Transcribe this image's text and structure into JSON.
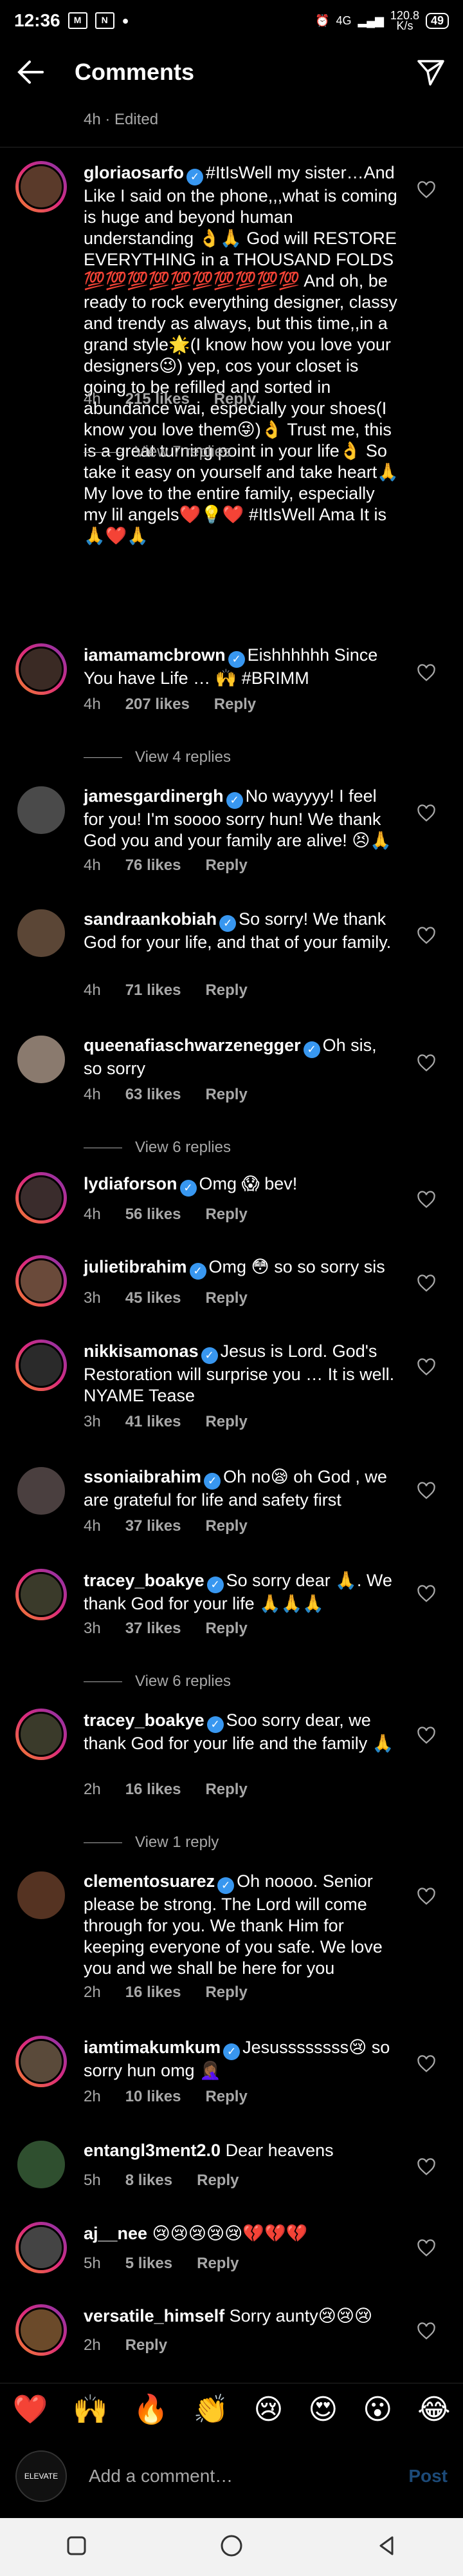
{
  "status_bar": {
    "time": "12:36",
    "net_speed": "120.8",
    "net_unit": "K/s",
    "signal": "4G",
    "battery": "49"
  },
  "header": {
    "title": "Comments"
  },
  "edited_caption": "4h · Edited",
  "labels": {
    "likes_suffix": "likes",
    "reply": "Reply"
  },
  "comments": [
    {
      "username": "gloriaosarfo",
      "verified": true,
      "text": "#ItIsWell my sister…And Like I said on the phone,,,what is coming is huge and beyond human understanding 👌🙏 God will RESTORE EVERYTHING in a THOUSAND FOLDS 💯💯💯💯💯💯💯💯💯💯 And oh, be ready to rock everything designer, classy and trendy as always, but this time,,in a grand style🌟(I know how you love your designers😉) yep, cos your closet is going to be refilled and sorted in abundance wai, especially your shoes(I know you love them😜)👌 Trust me, this is a great turning point in your life👌 So take it easy on yourself and take heart🙏 My love to the entire family, especially my lil angels❤️💡❤️ #ItIsWell Ama It is🙏❤️🙏",
      "time": "4h",
      "likes": "215 likes",
      "reply_link": "View 7 replies"
    },
    {
      "username": "iamamamcbrown",
      "verified": true,
      "text": "Eishhhhhh  Since You have Life … 🙌 #BRIMM",
      "time": "4h",
      "likes": "207 likes",
      "reply_link": "View 4 replies"
    },
    {
      "username": "jamesgardinergh",
      "verified": true,
      "text": "No wayyyy! I feel for you! I'm soooo sorry hun! We thank God you and your family are alive! 😣🙏",
      "time": "4h",
      "likes": "76 likes"
    },
    {
      "username": "sandraankobiah",
      "verified": true,
      "text": "So sorry! We thank God for your life, and that of your family.",
      "time": "4h",
      "likes": "71 likes"
    },
    {
      "username": "queenafiaschwarzenegger",
      "verified": true,
      "text": "Oh sis, so sorry",
      "time": "4h",
      "likes": "63 likes",
      "reply_link": "View 6 replies"
    },
    {
      "username": "lydiaforson",
      "verified": true,
      "text": "Omg 😱 bev!",
      "time": "4h",
      "likes": "56 likes"
    },
    {
      "username": "julietibrahim",
      "verified": true,
      "text": "Omg 😳 so so sorry sis",
      "time": "3h",
      "likes": "45 likes"
    },
    {
      "username": "nikkisamonas",
      "verified": true,
      "text": "Jesus is Lord. God's Restoration will surprise you … It is well. NYAME Tease",
      "time": "3h",
      "likes": "41 likes"
    },
    {
      "username": "ssoniaibrahim",
      "verified": true,
      "text": "Oh no😪 oh God , we are grateful for life and safety first",
      "time": "4h",
      "likes": "37 likes"
    },
    {
      "username": "tracey_boakye",
      "verified": true,
      "text": "So sorry dear 🙏. We thank God for your life 🙏🙏🙏",
      "time": "3h",
      "likes": "37 likes",
      "reply_link": "View 6 replies"
    },
    {
      "username": "tracey_boakye",
      "verified": true,
      "text": "Soo sorry dear, we thank God for your life and the family 🙏",
      "time": "2h",
      "likes": "16 likes",
      "reply_link": "View 1 reply"
    },
    {
      "username": "clementosuarez",
      "verified": true,
      "text": "Oh noooo. Senior please be strong. The Lord will come through for you. We thank Him for keeping everyone of you safe. We love you and we shall be here for you",
      "time": "2h",
      "likes": "16 likes"
    },
    {
      "username": "iamtimakumkum",
      "verified": true,
      "text": "Jesussssssss😢 so sorry hun omg 🤦🏾‍♀️",
      "time": "2h",
      "likes": "10 likes"
    },
    {
      "username": "entangl3ment2.0",
      "verified": false,
      "text": "Dear heavens",
      "time": "5h",
      "likes": "8 likes"
    },
    {
      "username": "aj__nee",
      "verified": false,
      "text": "😢😢😢😢😢💔💔💔",
      "time": "5h",
      "likes": "5 likes"
    },
    {
      "username": "versatile_himself",
      "verified": false,
      "text": "Sorry aunty😢😢😢",
      "time": "2h",
      "likes": ""
    }
  ],
  "emoji_bar": [
    "❤️",
    "🙌",
    "🔥",
    "👏",
    "😢",
    "😍",
    "😮",
    "😂"
  ],
  "input": {
    "placeholder": "Add a comment…",
    "post_label": "Post",
    "avatar_label": "ELEVATE"
  },
  "colors": {
    "verified": "#3897f0",
    "muted": "#a8a8a8",
    "post_disabled": "#1c4a78"
  }
}
